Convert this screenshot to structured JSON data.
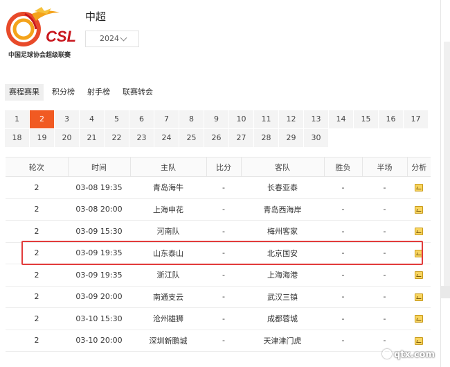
{
  "header": {
    "logo_text": "CSL",
    "logo_subtitle": "中国足球协会超级联赛",
    "title": "中超",
    "season": "2024"
  },
  "tabs": [
    {
      "label": "赛程赛果",
      "active": true
    },
    {
      "label": "积分榜",
      "active": false
    },
    {
      "label": "射手榜",
      "active": false
    },
    {
      "label": "联赛转会",
      "active": false
    }
  ],
  "rounds": {
    "active": "2",
    "row1": [
      "1",
      "2",
      "3",
      "4",
      "5",
      "6",
      "7",
      "8",
      "9",
      "10",
      "11",
      "12",
      "13",
      "14",
      "15",
      "16",
      "17"
    ],
    "row2": [
      "18",
      "19",
      "20",
      "21",
      "22",
      "23",
      "24",
      "25",
      "26",
      "27",
      "28",
      "29",
      "30"
    ]
  },
  "table": {
    "headers": [
      "轮次",
      "时间",
      "主队",
      "比分",
      "客队",
      "胜负",
      "半场",
      "分析"
    ],
    "rows": [
      {
        "round": "2",
        "time": "03-08 19:35",
        "home": "青岛海牛",
        "score": "-",
        "away": "长春亚泰",
        "result": "-",
        "half": "-"
      },
      {
        "round": "2",
        "time": "03-08 20:00",
        "home": "上海申花",
        "score": "-",
        "away": "青岛西海岸",
        "result": "-",
        "half": "-"
      },
      {
        "round": "2",
        "time": "03-09 15:30",
        "home": "河南队",
        "score": "-",
        "away": "梅州客家",
        "result": "-",
        "half": "-"
      },
      {
        "round": "2",
        "time": "03-09 19:35",
        "home": "山东泰山",
        "score": "-",
        "away": "北京国安",
        "result": "-",
        "half": "-"
      },
      {
        "round": "2",
        "time": "03-09 19:35",
        "home": "浙江队",
        "score": "-",
        "away": "上海海港",
        "result": "-",
        "half": "-"
      },
      {
        "round": "2",
        "time": "03-09 20:00",
        "home": "南通支云",
        "score": "-",
        "away": "武汉三镇",
        "result": "-",
        "half": "-"
      },
      {
        "round": "2",
        "time": "03-10 15:30",
        "home": "沧州雄狮",
        "score": "-",
        "away": "成都蓉城",
        "result": "-",
        "half": "-"
      },
      {
        "round": "2",
        "time": "03-10 20:00",
        "home": "深圳新鹏城",
        "score": "-",
        "away": "天津津门虎",
        "result": "-",
        "half": "-"
      }
    ]
  },
  "watermark": "qtx.com",
  "colors": {
    "accent": "#f15a22",
    "highlight": "#e23b3b",
    "score_dash": "#e3433d"
  }
}
